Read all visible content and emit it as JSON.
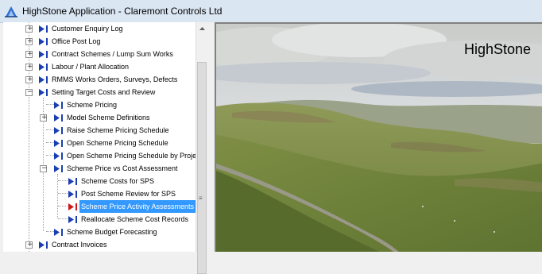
{
  "window": {
    "title": "HighStone Application - Claremont Controls Ltd"
  },
  "banner": {
    "brand_text": "HighStone"
  },
  "colors": {
    "node_icon": "#1a3fb0",
    "node_icon_active": "#d01818",
    "selection": "#3399ff"
  },
  "tree": {
    "items": [
      {
        "label": "Customer Enquiry Log",
        "expander": "+"
      },
      {
        "label": "Office Post Log",
        "expander": "+"
      },
      {
        "label": "Contract Schemes / Lump Sum Works",
        "expander": "+"
      },
      {
        "label": "Labour / Plant Allocation",
        "expander": "+"
      },
      {
        "label": "RMMS Works Orders, Surveys, Defects",
        "expander": "+"
      },
      {
        "label": "Setting Target Costs and Review",
        "expander": "−"
      },
      {
        "label": "Scheme Pricing",
        "expander": ""
      },
      {
        "label": "Model Scheme Definitions",
        "expander": "+"
      },
      {
        "label": "Raise Scheme Pricing Schedule",
        "expander": ""
      },
      {
        "label": "Open Scheme Pricing Schedule",
        "expander": ""
      },
      {
        "label": "Open Scheme Pricing Schedule by Project",
        "expander": ""
      },
      {
        "label": "Scheme Price vs Cost Assessment",
        "expander": "−"
      },
      {
        "label": "Scheme Costs for SPS",
        "expander": ""
      },
      {
        "label": "Post Scheme Review for SPS",
        "expander": ""
      },
      {
        "label": "Scheme Price Activity Assessments",
        "expander": "",
        "selected": true
      },
      {
        "label": "Reallocate Scheme Cost Records",
        "expander": ""
      },
      {
        "label": "Scheme Budget Forecasting",
        "expander": ""
      },
      {
        "label": "Contract Invoices",
        "expander": "+"
      }
    ]
  }
}
